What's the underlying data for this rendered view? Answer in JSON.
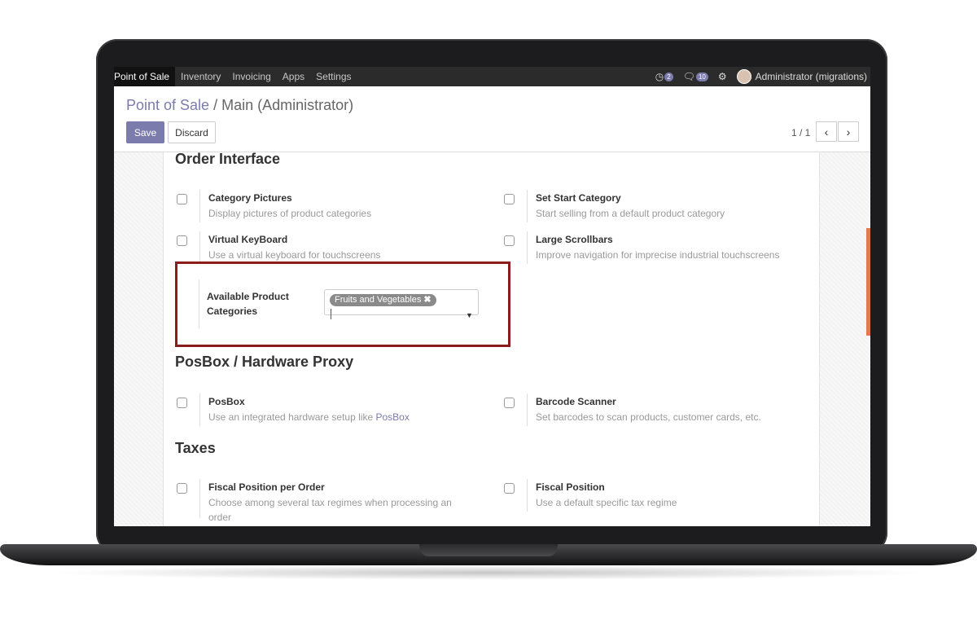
{
  "navbar": {
    "apps": [
      {
        "label": "Point of Sale",
        "active": true
      },
      {
        "label": "Inventory",
        "active": false
      },
      {
        "label": "Invoicing",
        "active": false
      },
      {
        "label": "Apps",
        "active": false
      },
      {
        "label": "Settings",
        "active": false
      }
    ],
    "activity_count": "2",
    "messages_count": "10",
    "user": "Administrator (migrations)"
  },
  "control_panel": {
    "breadcrumb_parent": "Point of Sale",
    "breadcrumb_separator": "/",
    "breadcrumb_current": "Main (Administrator)",
    "save_label": "Save",
    "discard_label": "Discard",
    "pager_value": "1 / 1"
  },
  "sections": {
    "order_interface": "Order Interface",
    "posbox": "PosBox / Hardware Proxy",
    "taxes": "Taxes"
  },
  "settings": {
    "category_pictures": {
      "label": "Category Pictures",
      "desc": "Display pictures of product categories",
      "checked": false
    },
    "set_start_category": {
      "label": "Set Start Category",
      "desc": "Start selling from a default product category",
      "checked": false
    },
    "virtual_keyboard": {
      "label": "Virtual KeyBoard",
      "desc": "Use a virtual keyboard for touchscreens",
      "checked": false
    },
    "large_scrollbars": {
      "label": "Large Scrollbars",
      "desc": "Improve navigation for imprecise industrial touchscreens",
      "checked": false
    },
    "available_categories": {
      "label": "Available Product Categories",
      "tags": [
        "Fruits and Vegetables"
      ]
    },
    "posbox": {
      "label": "PosBox",
      "desc": "Use an integrated hardware setup like",
      "link": "PosBox",
      "checked": false
    },
    "barcode_scanner": {
      "label": "Barcode Scanner",
      "desc": "Set barcodes to scan products, customer cards, etc.",
      "checked": false
    },
    "fiscal_position_per_order": {
      "label": "Fiscal Position per Order",
      "desc": "Choose among several tax regimes when processing an order",
      "checked": false
    },
    "fiscal_position": {
      "label": "Fiscal Position",
      "desc": "Use a default specific tax regime",
      "checked": false
    }
  },
  "colors": {
    "accent": "#7c7bad",
    "highlight_border": "#8c1c1c",
    "navbar": "#2b2b2b"
  }
}
